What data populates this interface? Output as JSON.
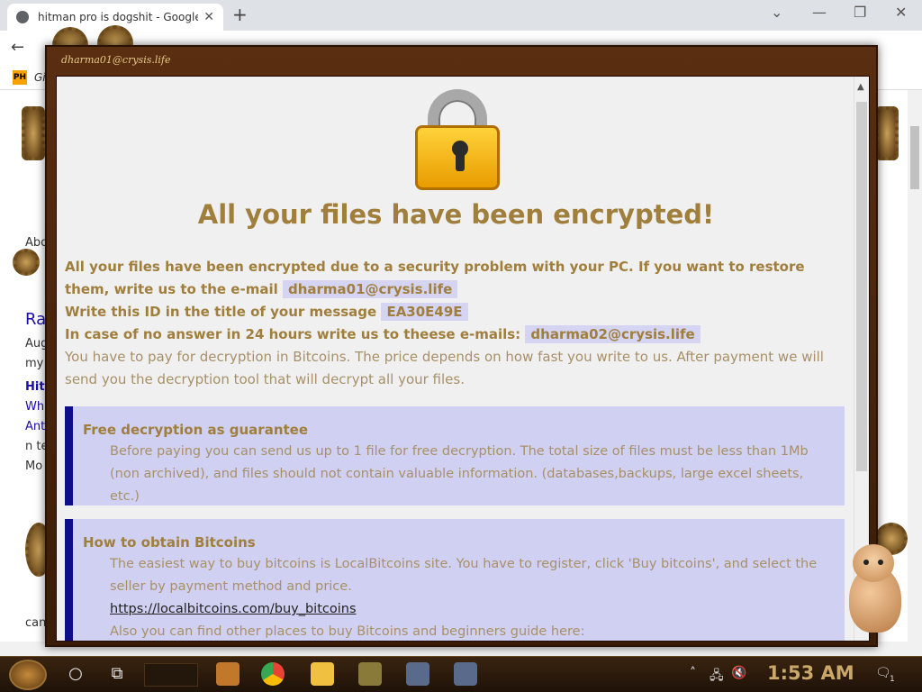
{
  "browser": {
    "tab_title": "hitman pro is dogshit - Google",
    "tab_close": "✕",
    "new_tab": "+",
    "minimize": "—",
    "restore": "❐",
    "close": "✕",
    "bookmark_badge": "PH",
    "bookmark_text": "Gi"
  },
  "page_snippets": {
    "s1": "Abo",
    "s2": "Ra",
    "s3": "Aug",
    "s4": "my",
    "s5": "Hitr",
    "s6": "Wha",
    "s7": "Ant",
    "s8": "n te",
    "s9": "Mo",
    "s10": "can"
  },
  "ransom": {
    "window_title": "dharma01@crysis.life",
    "headline": "All your files have been encrypted!",
    "line1_prefix": "All your files have been encrypted due to a security problem with your PC. If you want to restore them, write us to the e-mail",
    "email1": "dharma01@crysis.life",
    "line2_prefix": "Write this ID in the title of your message",
    "id": "EA30E49E",
    "line3_prefix": "In case of no answer in 24 hours write us to theese e-mails:",
    "email2": "dharma02@crysis.life",
    "line4": "You have to pay for decryption in Bitcoins. The price depends on how fast you write to us. After payment we will send you the decryption tool that will decrypt all your files.",
    "card1_title": "Free decryption as guarantee",
    "card1_text": "Before paying you can send us up to 1 file for free decryption. The total size of files must be less than 1Mb (non archived), and files should not contain valuable information. (databases,backups, large excel sheets, etc.)",
    "card2_title": "How to obtain Bitcoins",
    "card2_text": "The easiest way to buy bitcoins is LocalBitcoins site. You have to register, click 'Buy bitcoins', and select the seller by payment method and price.",
    "card2_link": "https://localbitcoins.com/buy_bitcoins",
    "card2_text2": "Also you can find other places to buy Bitcoins and beginners guide here:"
  },
  "taskbar": {
    "clock": "1:53 AM",
    "notif_count": "1"
  },
  "colors": {
    "gold_text": "#a07e3c",
    "card_bg": "#d0d0f2",
    "card_accent": "#0e0e8a",
    "frame": "#5a2e10"
  }
}
